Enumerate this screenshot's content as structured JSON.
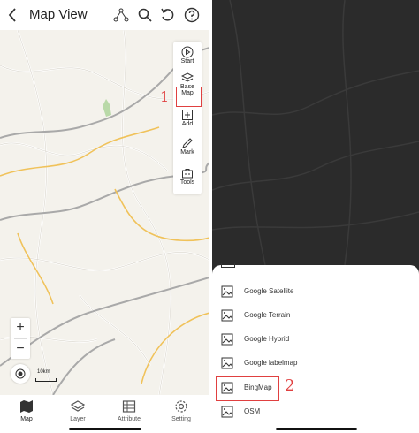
{
  "left": {
    "header": {
      "title": "Map View"
    },
    "toolbar": [
      {
        "label": "Start"
      },
      {
        "label": "Base Map"
      },
      {
        "label": "Add"
      },
      {
        "label": "Mark"
      },
      {
        "label": "Tools"
      }
    ],
    "base_map_split": [
      "Base",
      "Map"
    ],
    "callout_1": "1",
    "zoom": {
      "in": "+",
      "out": "−"
    },
    "scale": "10km",
    "tabs": [
      {
        "label": "Map",
        "active": true
      },
      {
        "label": "Layer"
      },
      {
        "label": "Attribute"
      },
      {
        "label": "Setting"
      }
    ]
  },
  "right": {
    "basemaps": [
      {
        "label": "Google Satellite"
      },
      {
        "label": "Google Terrain"
      },
      {
        "label": "Google Hybrid"
      },
      {
        "label": "Google labelmap"
      },
      {
        "label": "BingMap",
        "highlighted": true
      },
      {
        "label": "OSM"
      }
    ],
    "callout_2": "2"
  },
  "colors": {
    "highlight": "#e04040",
    "map_bg": "#f4f2ec",
    "dark_map": "#2b2b2b"
  }
}
